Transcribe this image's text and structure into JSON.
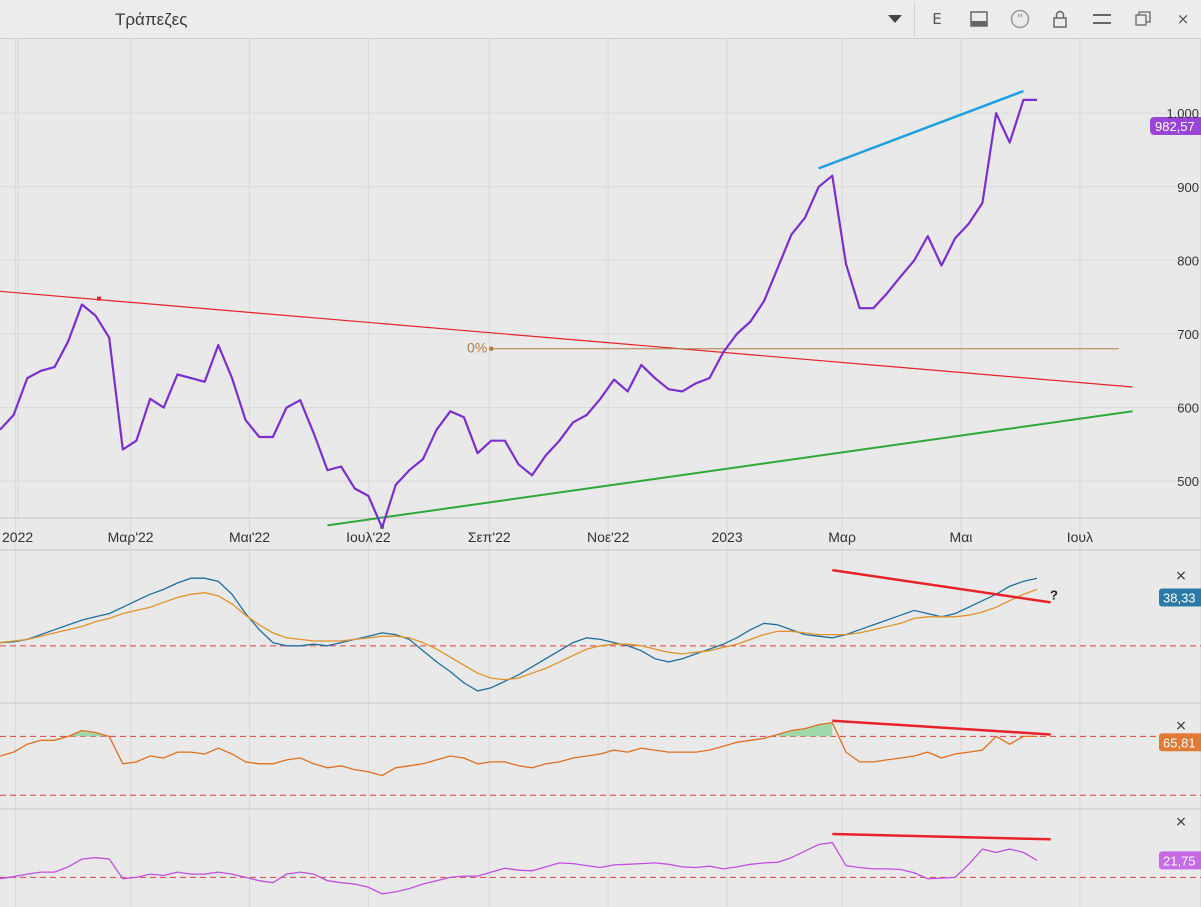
{
  "window": {
    "title": "Τράπεζες",
    "toolbar": {
      "dropdown_icon": "chevron-down-icon",
      "e_label": "E",
      "icons": [
        "panel-icon",
        "quote-icon",
        "lock-icon",
        "menu-icon",
        "restore-icon",
        "close-icon"
      ],
      "close_label": "×"
    }
  },
  "chart_data": [
    {
      "type": "line",
      "x_axis_ticks": [
        "2022",
        "Μαρ'22",
        "Μαι'22",
        "Ιουλ'22",
        "Σεπ'22",
        "Νοε'22",
        "2023",
        "Μαρ",
        "Μαι",
        "Ιουλ"
      ],
      "y_axis_ticks": [
        "500",
        "600",
        "700",
        "800",
        "900",
        "1.000"
      ],
      "ylim": [
        450,
        1060
      ],
      "last_value_label": "982,57",
      "series_color": "#7b2fd0",
      "x": [
        "2021-12-24",
        "2021-12-31",
        "2022-01-07",
        "2022-01-14",
        "2022-01-21",
        "2022-01-28",
        "2022-02-04",
        "2022-02-11",
        "2022-02-18",
        "2022-02-25",
        "2022-03-04",
        "2022-03-11",
        "2022-03-18",
        "2022-03-25",
        "2022-04-01",
        "2022-04-08",
        "2022-04-15",
        "2022-04-22",
        "2022-04-29",
        "2022-05-06",
        "2022-05-13",
        "2022-05-20",
        "2022-05-27",
        "2022-06-03",
        "2022-06-10",
        "2022-06-17",
        "2022-06-24",
        "2022-07-01",
        "2022-07-08",
        "2022-07-15",
        "2022-07-22",
        "2022-07-29",
        "2022-08-05",
        "2022-08-12",
        "2022-08-19",
        "2022-08-26",
        "2022-09-02",
        "2022-09-09",
        "2022-09-16",
        "2022-09-23",
        "2022-09-30",
        "2022-10-07",
        "2022-10-14",
        "2022-10-21",
        "2022-10-28",
        "2022-11-04",
        "2022-11-11",
        "2022-11-18",
        "2022-11-25",
        "2022-12-02",
        "2022-12-09",
        "2022-12-16",
        "2022-12-23",
        "2022-12-30",
        "2023-01-06",
        "2023-01-13",
        "2023-01-20",
        "2023-01-27",
        "2023-02-03",
        "2023-02-10",
        "2023-02-17",
        "2023-02-24",
        "2023-03-03",
        "2023-03-10",
        "2023-03-17",
        "2023-03-24",
        "2023-03-31",
        "2023-04-07",
        "2023-04-14",
        "2023-04-21",
        "2023-04-28",
        "2023-05-05",
        "2023-05-12",
        "2023-05-19",
        "2023-05-26",
        "2023-06-02",
        "2023-06-09"
      ],
      "values": [
        570,
        590,
        640,
        650,
        655,
        690,
        740,
        725,
        695,
        543,
        555,
        612,
        600,
        645,
        640,
        635,
        685,
        640,
        583,
        560,
        560,
        600,
        610,
        565,
        515,
        520,
        490,
        480,
        437,
        495,
        515,
        530,
        570,
        595,
        587,
        538,
        555,
        555,
        523,
        508,
        535,
        555,
        580,
        590,
        612,
        638,
        622,
        658,
        640,
        625,
        622,
        633,
        640,
        675,
        700,
        717,
        745,
        790,
        835,
        858,
        900,
        915,
        795,
        735,
        735,
        755,
        778,
        800,
        833,
        793,
        830,
        850,
        878,
        1000,
        960,
        1018,
        1018,
        982.57
      ],
      "trend_lines": [
        {
          "color": "#e8232a",
          "from": [
            "2021-12-24",
            758
          ],
          "to": [
            "2023-07-28",
            628
          ]
        },
        {
          "color": "#2fa83a",
          "from": [
            "2022-06-10",
            440
          ],
          "to": [
            "2023-07-28",
            595
          ]
        },
        {
          "color": "#1ea0e0",
          "from": [
            "2023-02-17",
            925
          ],
          "to": [
            "2023-06-02",
            1030
          ]
        }
      ],
      "fib_line": {
        "label": "0%",
        "value": 680,
        "from": "2022-09-02",
        "to": "2023-07-21",
        "color": "#b07a4a"
      }
    },
    {
      "type": "line",
      "panel": "indicator-1",
      "last_value_label": "38,33",
      "series": [
        {
          "color": "#1f6fa0",
          "values": [
            0,
            0.5,
            2,
            5,
            8,
            11,
            14,
            16,
            18,
            22,
            26,
            30,
            33,
            37,
            40,
            40,
            38,
            30,
            18,
            8,
            0,
            -2,
            -2,
            -1,
            -2,
            0,
            2,
            4,
            6,
            5,
            2,
            -5,
            -12,
            -18,
            -25,
            -30,
            -28,
            -24,
            -20,
            -15,
            -10,
            -5,
            0,
            3,
            2,
            0,
            -2,
            -5,
            -10,
            -12,
            -10,
            -7,
            -4,
            -1,
            3,
            8,
            12,
            11,
            8,
            5,
            4,
            3,
            5,
            8,
            11,
            14,
            17,
            20,
            18,
            16,
            18,
            22,
            26,
            30,
            35,
            38,
            40,
            36,
            33,
            28
          ]
        },
        {
          "color": "#e0932b",
          "values": [
            0,
            1,
            2,
            4,
            6,
            8,
            10,
            13,
            15,
            18,
            20,
            22,
            25,
            28,
            30,
            31,
            29,
            24,
            17,
            11,
            6,
            3,
            2,
            1,
            1,
            1,
            2,
            3,
            4,
            4,
            3,
            0,
            -4,
            -9,
            -14,
            -19,
            -22,
            -23,
            -22,
            -19,
            -16,
            -12,
            -8,
            -4,
            -2,
            -1,
            -1,
            -2,
            -4,
            -6,
            -7,
            -6,
            -5,
            -3,
            -1,
            2,
            5,
            7,
            7,
            6,
            5,
            5,
            5,
            6,
            8,
            10,
            12,
            15,
            16,
            16,
            16,
            17,
            19,
            22,
            26,
            30,
            33,
            34,
            34,
            33
          ]
        }
      ],
      "reference_value": -2,
      "divergence_line": {
        "color": "#e8232a",
        "from": [
          "2023-02-24",
          45
        ],
        "to": [
          "2023-06-16",
          25
        ]
      },
      "annotation": "?",
      "ylim": [
        -35,
        55
      ]
    },
    {
      "type": "area",
      "panel": "indicator-2",
      "last_value_label": "65,81",
      "series": [
        {
          "color": "#e07020",
          "values": [
            60,
            62,
            66,
            68,
            68,
            70,
            73,
            72,
            70,
            56,
            57,
            60,
            59,
            62,
            62,
            61,
            64,
            61,
            57,
            56,
            56,
            58,
            59,
            56,
            54,
            55,
            53,
            52,
            50,
            54,
            55,
            56,
            58,
            60,
            59,
            56,
            57,
            57,
            55,
            54,
            56,
            57,
            59,
            60,
            61,
            63,
            62,
            64,
            63,
            62,
            62,
            62,
            63,
            65,
            67,
            68,
            69,
            71,
            73,
            74,
            76,
            77,
            62,
            57,
            57,
            58,
            59,
            60,
            62,
            59,
            61,
            62,
            63,
            70,
            66,
            70,
            70,
            67
          ]
        }
      ],
      "reference_lines": [
        70,
        40
      ],
      "divergence_line": {
        "color": "#e8232a",
        "from": [
          "2023-02-24",
          78
        ],
        "to": [
          "2023-06-16",
          71
        ]
      },
      "ylim": [
        35,
        85
      ]
    },
    {
      "type": "line",
      "panel": "indicator-3",
      "last_value_label": "21,75",
      "series": [
        {
          "color": "#c050e0",
          "values": [
            20,
            20.3,
            20.7,
            21,
            21,
            21.8,
            23,
            23.2,
            23,
            20,
            20.2,
            20.7,
            20.5,
            21,
            20.7,
            20.7,
            21,
            20.7,
            20.2,
            19.7,
            19.4,
            20.7,
            21,
            20.7,
            19.7,
            19.4,
            19.2,
            18.7,
            17.7,
            18,
            18.5,
            19.2,
            19.7,
            20.2,
            20.4,
            20.4,
            21,
            21.6,
            21.3,
            21.2,
            21.8,
            22.4,
            22.3,
            22,
            21.7,
            22.1,
            22.2,
            22.3,
            22.4,
            22.2,
            21.8,
            21.7,
            21.9,
            21.5,
            21.8,
            22.2,
            22.4,
            22.5,
            23.2,
            24.2,
            25.2,
            25.5,
            22,
            21.7,
            21.5,
            21.5,
            21.4,
            20.9,
            20,
            20.1,
            20.2,
            22.2,
            24.5,
            24,
            24.5,
            24,
            22.8
          ]
        }
      ],
      "reference_value": 20.2,
      "divergence_line": {
        "color": "#e8232a",
        "from": [
          "2023-02-24",
          26.8
        ],
        "to": [
          "2023-06-16",
          26
        ]
      },
      "ylim": [
        16,
        30
      ]
    }
  ]
}
